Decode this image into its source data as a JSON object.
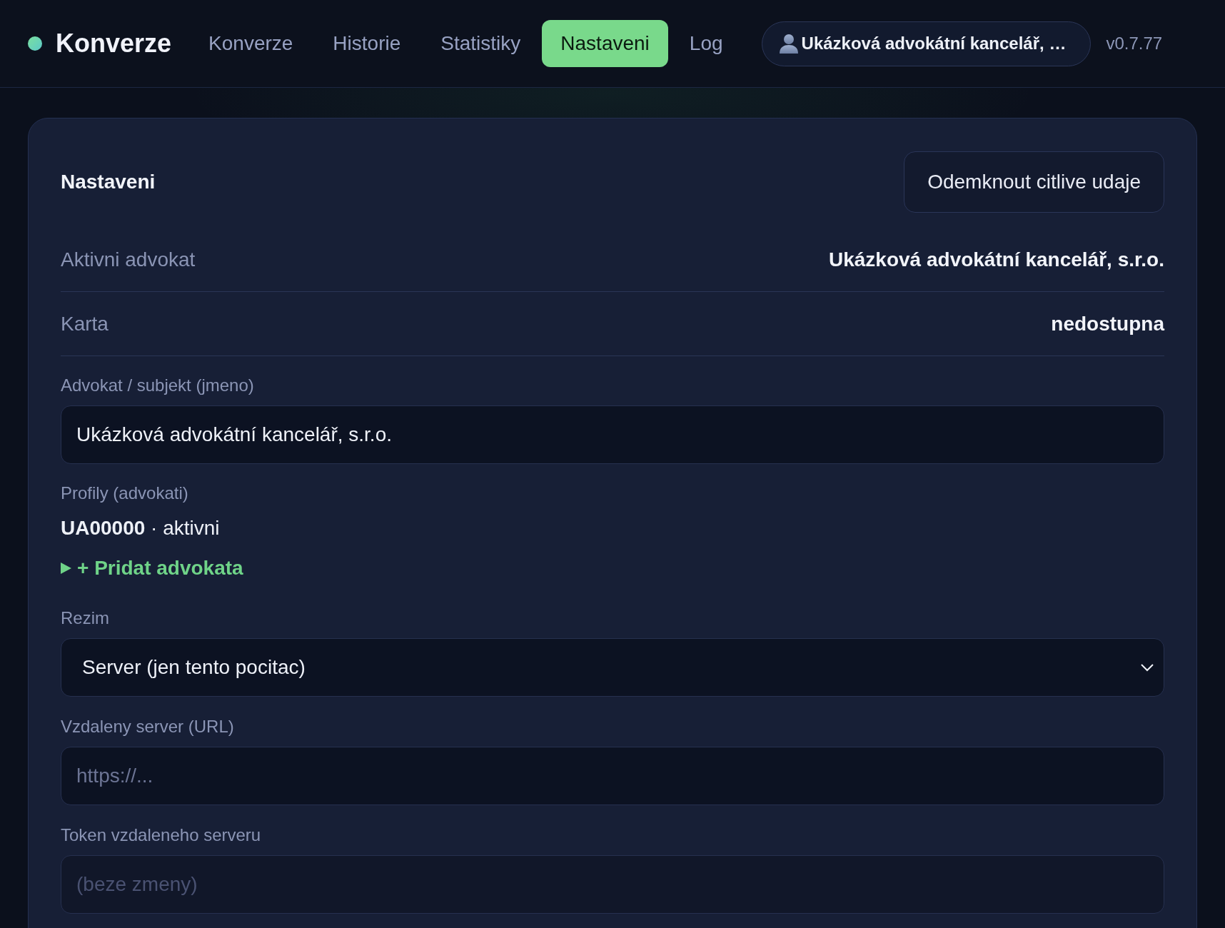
{
  "header": {
    "brand": "Konverze",
    "tabs": [
      {
        "label": "Konverze",
        "selected": false
      },
      {
        "label": "Historie",
        "selected": false
      },
      {
        "label": "Statistiky",
        "selected": false
      },
      {
        "label": "Nastaveni",
        "selected": true
      },
      {
        "label": "Log",
        "selected": false
      }
    ],
    "account": "Ukázková advokátní kancelář, …",
    "version": "v0.7.77"
  },
  "settings": {
    "title": "Nastaveni",
    "unlock_button": "Odemknout citlive udaje",
    "info_rows": [
      {
        "label": "Aktivni advokat",
        "value": "Ukázková advokátní kancelář, s.r.o."
      },
      {
        "label": "Karta",
        "value": "nedostupna"
      }
    ],
    "name_field": {
      "label": "Advokat / subjekt (jmeno)",
      "value": "Ukázková advokátní kancelář, s.r.o."
    },
    "profiles": {
      "label": "Profily (advokati)",
      "items": [
        "**UA00000** · aktivni"
      ],
      "add_lawyer": {
        "label": "+ Pridat advokata",
        "expanded": false
      }
    },
    "mode_select": {
      "label": "Rezim",
      "value": "Server (jen tento pocitac)"
    },
    "remote_url": {
      "label": "Vzdaleny server (URL)",
      "placeholder": "https://...",
      "disabled": false
    },
    "remote_token": {
      "label": "Token vzdaleneho serveru",
      "placeholder": "(beze zmeny)",
      "disabled": true
    }
  }
}
